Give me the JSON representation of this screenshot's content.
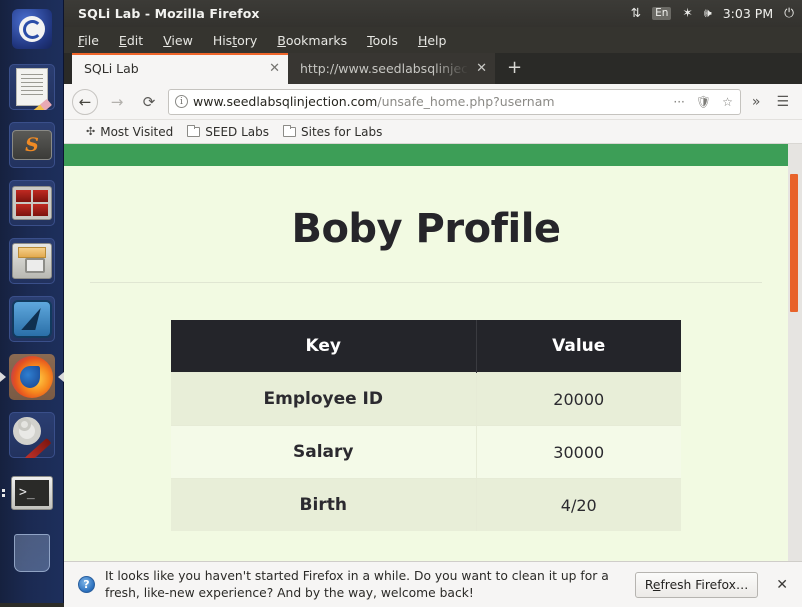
{
  "window": {
    "title": "SQLi Lab - Mozilla Firefox"
  },
  "tray": {
    "network_icon": "network-updown-icon",
    "network_glyph": "⇅",
    "keyboard_layout": "En",
    "bluetooth_glyph": "✶",
    "volume_glyph": "🕪",
    "time": "3:03 PM",
    "power_glyph": "⏻"
  },
  "menubar": {
    "items": [
      {
        "pre": "",
        "mnem": "F",
        "post": "ile"
      },
      {
        "pre": "",
        "mnem": "E",
        "post": "dit"
      },
      {
        "pre": "",
        "mnem": "V",
        "post": "iew"
      },
      {
        "pre": "His",
        "mnem": "t",
        "post": "ory"
      },
      {
        "pre": "",
        "mnem": "B",
        "post": "ookmarks"
      },
      {
        "pre": "",
        "mnem": "T",
        "post": "ools"
      },
      {
        "pre": "",
        "mnem": "H",
        "post": "elp"
      }
    ]
  },
  "tabs": {
    "items": [
      {
        "label": "SQLi Lab",
        "active": true
      },
      {
        "label": "http://www.seedlabsqlinjec",
        "active": false
      }
    ],
    "close_glyph": "✕",
    "new_tab_glyph": "+"
  },
  "toolbar": {
    "back_glyph": "←",
    "forward_glyph": "→",
    "reload_glyph": "⟳",
    "info_glyph": "i",
    "url_domain": "www.seedlabsqlinjection.com",
    "url_path": "/unsafe_home.php?usernam",
    "page_actions_glyph": "···",
    "pocket_glyph": "🛡",
    "star_glyph": "☆",
    "overflow_glyph": "»",
    "menu_glyph": "☰"
  },
  "bookmarks": {
    "items": [
      {
        "label": "Most Visited",
        "icon": "gear-icon"
      },
      {
        "label": "SEED Labs",
        "icon": "folder-icon"
      },
      {
        "label": "Sites for Labs",
        "icon": "folder-icon"
      }
    ]
  },
  "page": {
    "navbar_color": "#3d9e57",
    "background_color": "#f2fae2",
    "title": "Boby Profile",
    "table": {
      "headers": [
        "Key",
        "Value"
      ],
      "rows": [
        [
          "Employee ID",
          "20000"
        ],
        [
          "Salary",
          "30000"
        ],
        [
          "Birth",
          "4/20"
        ]
      ]
    }
  },
  "notification": {
    "icon": "help-circle-icon",
    "icon_glyph": "?",
    "message": "It looks like you haven't started Firefox in a while. Do you want to clean it up for a fresh, like-new experience? And by the way, welcome back!",
    "button_pre": "R",
    "button_mnem": "e",
    "button_post": "fresh Firefox…",
    "close_glyph": "✕"
  },
  "launcher": {
    "items": [
      {
        "name": "ubuntu-dash",
        "label": "Ubuntu Dash"
      },
      {
        "name": "text-editor",
        "label": "Text Editor"
      },
      {
        "name": "sublime-text",
        "label": "Sublime Text",
        "glyph": "S"
      },
      {
        "name": "virtual-machine",
        "label": "Virtual Machine Manager"
      },
      {
        "name": "file-manager",
        "label": "Files"
      },
      {
        "name": "wireshark",
        "label": "Wireshark"
      },
      {
        "name": "firefox",
        "label": "Firefox",
        "selected": true
      },
      {
        "name": "settings",
        "label": "System Settings"
      },
      {
        "name": "terminal",
        "label": "Terminal",
        "glyph": ">_",
        "running": true
      },
      {
        "name": "trash",
        "label": "Trash"
      }
    ]
  }
}
